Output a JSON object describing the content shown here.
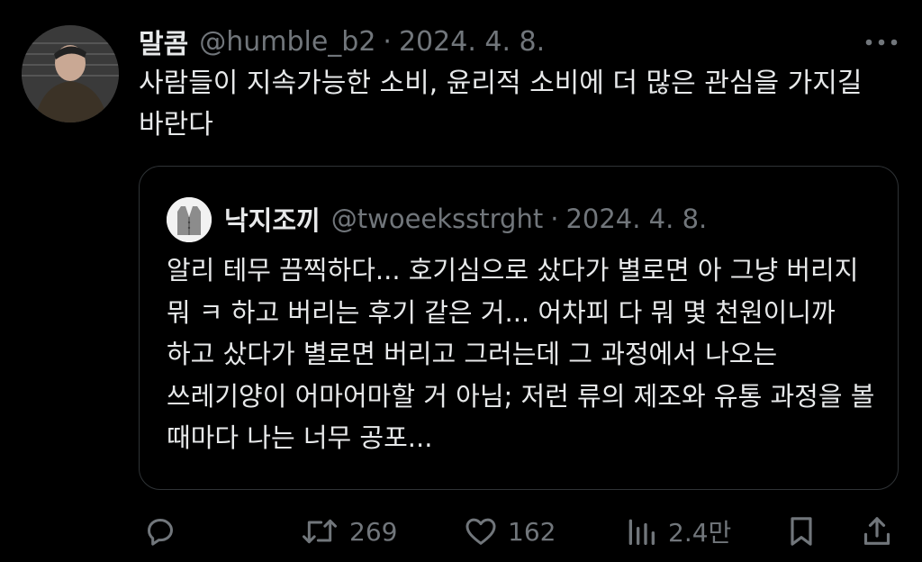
{
  "tweet": {
    "author_name": "말콤",
    "author_handle": "@humble_b2",
    "separator": "·",
    "date": "2024. 4. 8.",
    "text": "사람들이 지속가능한 소비, 윤리적 소비에 더 많은 관심을 가지길 바란다"
  },
  "quoted": {
    "author_name": "낙지조끼",
    "author_handle": "@twoeeksstrght",
    "separator": "·",
    "date": "2024. 4. 8.",
    "text": "알리 테무 끔찍하다... 호기심으로 샀다가 별로면 아 그냥 버리지 뭐 ㅋ 하고 버리는 후기 같은 거... 어차피 다 뭐 몇 천원이니까 하고 샀다가 별로면 버리고 그러는데 그 과정에서 나오는 쓰레기양이 어마어마할 거 아님; 저런 류의 제조와 유통 과정을 볼 때마다 나는 너무 공포..."
  },
  "actions": {
    "replies_icon": "reply-icon",
    "retweets": "269",
    "likes": "162",
    "views": "2.4만",
    "bookmark_icon": "bookmark-icon",
    "share_icon": "share-icon"
  },
  "colors": {
    "background": "#000000",
    "text_primary": "#e7e9ea",
    "text_secondary": "#71767b",
    "border": "#2f3336"
  }
}
